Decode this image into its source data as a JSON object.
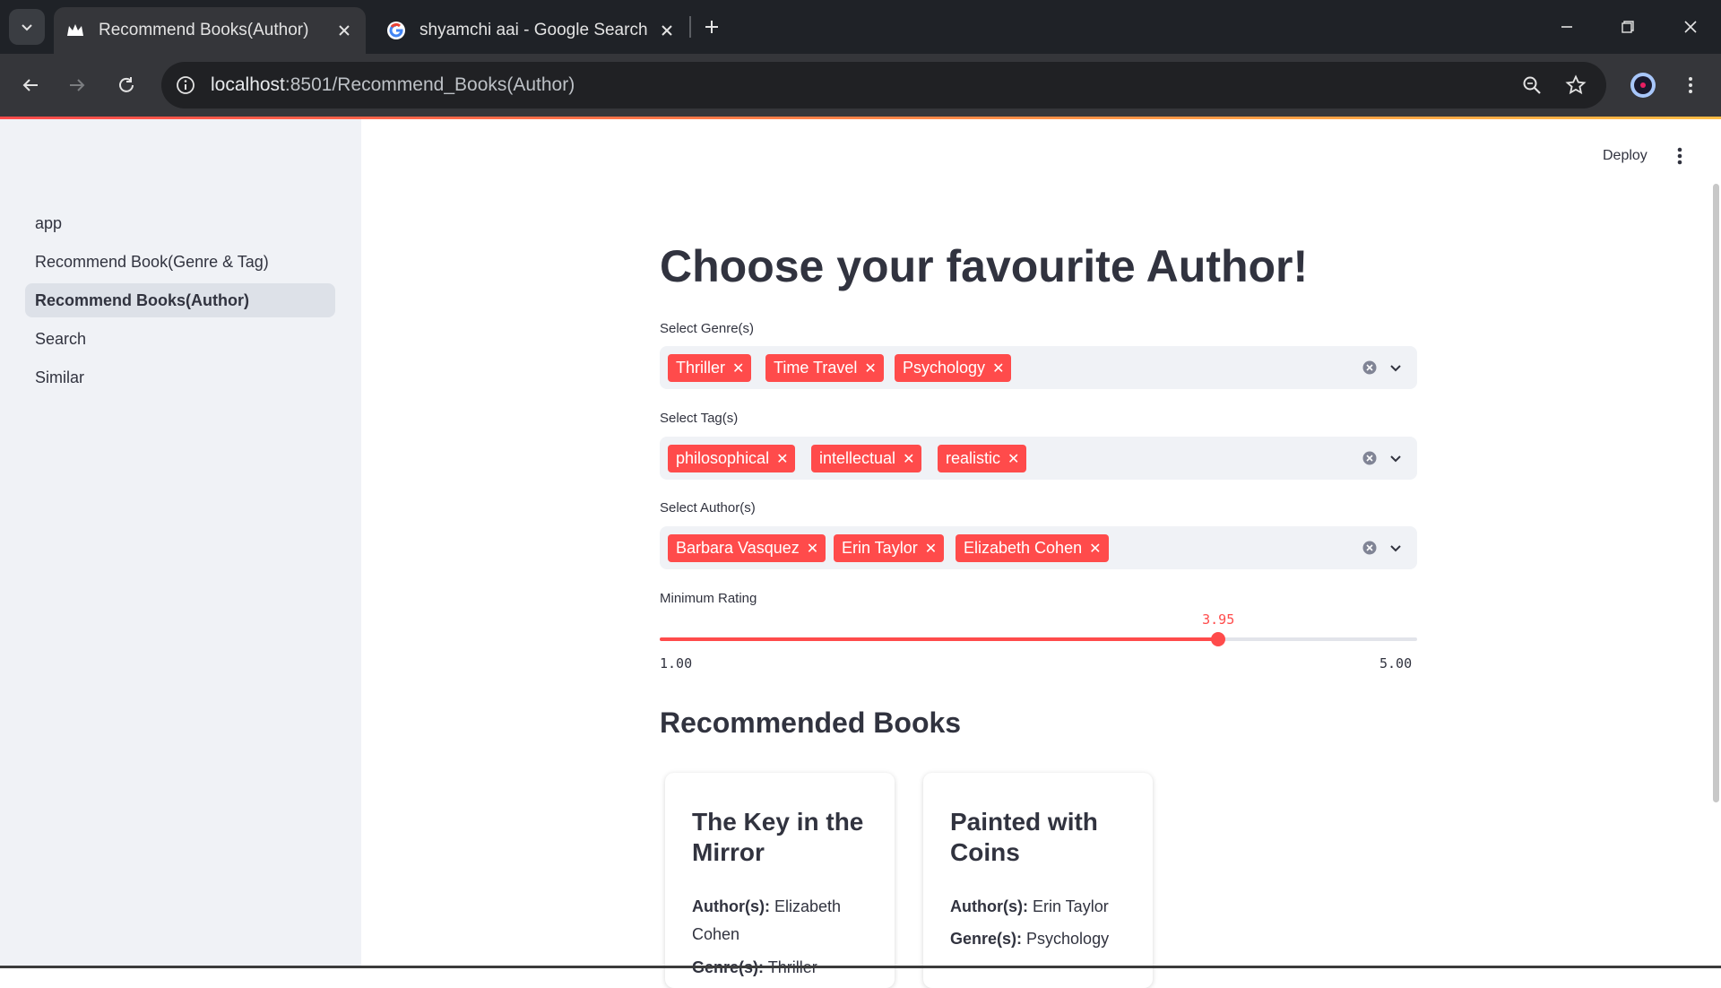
{
  "browser": {
    "tabs": [
      {
        "title": "Recommend Books(Author)",
        "favicon": "streamlit-crown-icon",
        "active": true
      },
      {
        "title": "shyamchi aai - Google Search",
        "favicon": "google-icon",
        "active": false
      }
    ],
    "url_host": "localhost",
    "url_rest": ":8501/Recommend_Books(Author)"
  },
  "sidebar": {
    "items": [
      {
        "label": "app",
        "active": false
      },
      {
        "label": "Recommend Book(Genre & Tag)",
        "active": false
      },
      {
        "label": "Recommend Books(Author)",
        "active": true
      },
      {
        "label": "Search",
        "active": false
      },
      {
        "label": "Similar",
        "active": false
      }
    ]
  },
  "header": {
    "deploy_label": "Deploy"
  },
  "main": {
    "title": "Choose your favourite Author!",
    "genres": {
      "label": "Select Genre(s)",
      "selected": [
        "Thriller",
        "Time Travel",
        "Psychology"
      ]
    },
    "tags": {
      "label": "Select Tag(s)",
      "selected": [
        "philosophical",
        "intellectual",
        "realistic"
      ]
    },
    "authors": {
      "label": "Select Author(s)",
      "selected": [
        "Barbara Vasquez",
        "Erin Taylor",
        "Elizabeth Cohen"
      ]
    },
    "rating": {
      "label": "Minimum Rating",
      "value": "3.95",
      "min": "1.00",
      "max": "5.00",
      "value_num": 3.95,
      "min_num": 1.0,
      "max_num": 5.0
    },
    "recommended_heading": "Recommended Books",
    "books": [
      {
        "title": "The Key in the Mirror",
        "author_label": "Author(s):",
        "author": "Elizabeth Cohen",
        "genre_label": "Genre(s):",
        "genre": "Thriller"
      },
      {
        "title": "Painted with Coins",
        "author_label": "Author(s):",
        "author": "Erin Taylor",
        "genre_label": "Genre(s):",
        "genre": "Psychology"
      }
    ]
  },
  "colors": {
    "accent": "#ff4b4b",
    "sidebar_bg": "#f0f2f6",
    "text": "#31333f",
    "chrome_dark": "#1f2227"
  }
}
